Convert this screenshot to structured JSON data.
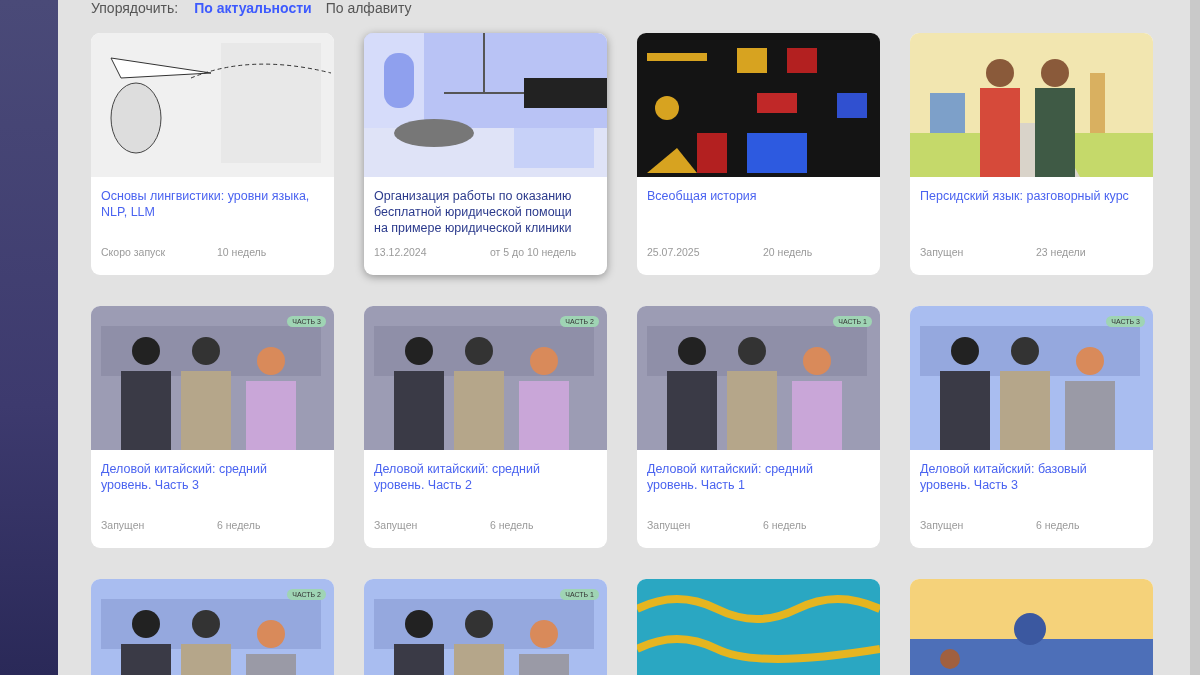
{
  "sort": {
    "label": "Упорядочить:",
    "options": [
      {
        "label": "По актуальности",
        "selected": true
      },
      {
        "label": "По алфавиту",
        "selected": false
      }
    ]
  },
  "cards": [
    {
      "title": "Основы лингвистики: уровни языка, NLP, LLM",
      "status": "Скоро запуск",
      "duration": "10 недель",
      "hovered": false
    },
    {
      "title": "Организация работы по оказанию бесплатной юридической помощи на примере юридической клиники",
      "status": "13.12.2024",
      "duration": "от 5 до 10 недель",
      "hovered": true
    },
    {
      "title": "Всеобщая история",
      "status": "25.07.2025",
      "duration": "20 недель",
      "hovered": false
    },
    {
      "title": "Персидский язык: разговорный курс",
      "status": "Запущен",
      "duration": "23 недели",
      "hovered": false
    },
    {
      "title": "Деловой китайский: средний уровень. Часть 3",
      "status": "Запущен",
      "duration": "6 недель",
      "badge": "ЧАСТЬ 3",
      "hovered": false
    },
    {
      "title": "Деловой китайский: средний уровень. Часть 2",
      "status": "Запущен",
      "duration": "6 недель",
      "badge": "ЧАСТЬ 2",
      "hovered": false
    },
    {
      "title": "Деловой китайский: средний уровень. Часть 1",
      "status": "Запущен",
      "duration": "6 недель",
      "badge": "ЧАСТЬ 1",
      "hovered": false
    },
    {
      "title": "Деловой китайский: базовый уровень. Часть 3",
      "status": "Запущен",
      "duration": "6 недель",
      "badge": "ЧАСТЬ 3",
      "hovered": false
    },
    {
      "badge": "ЧАСТЬ 2"
    },
    {
      "badge": "ЧАСТЬ 1"
    },
    {
      "image": {
        "kind": "picture"
      }
    },
    {
      "image": {
        "kind": "picture"
      }
    }
  ]
}
